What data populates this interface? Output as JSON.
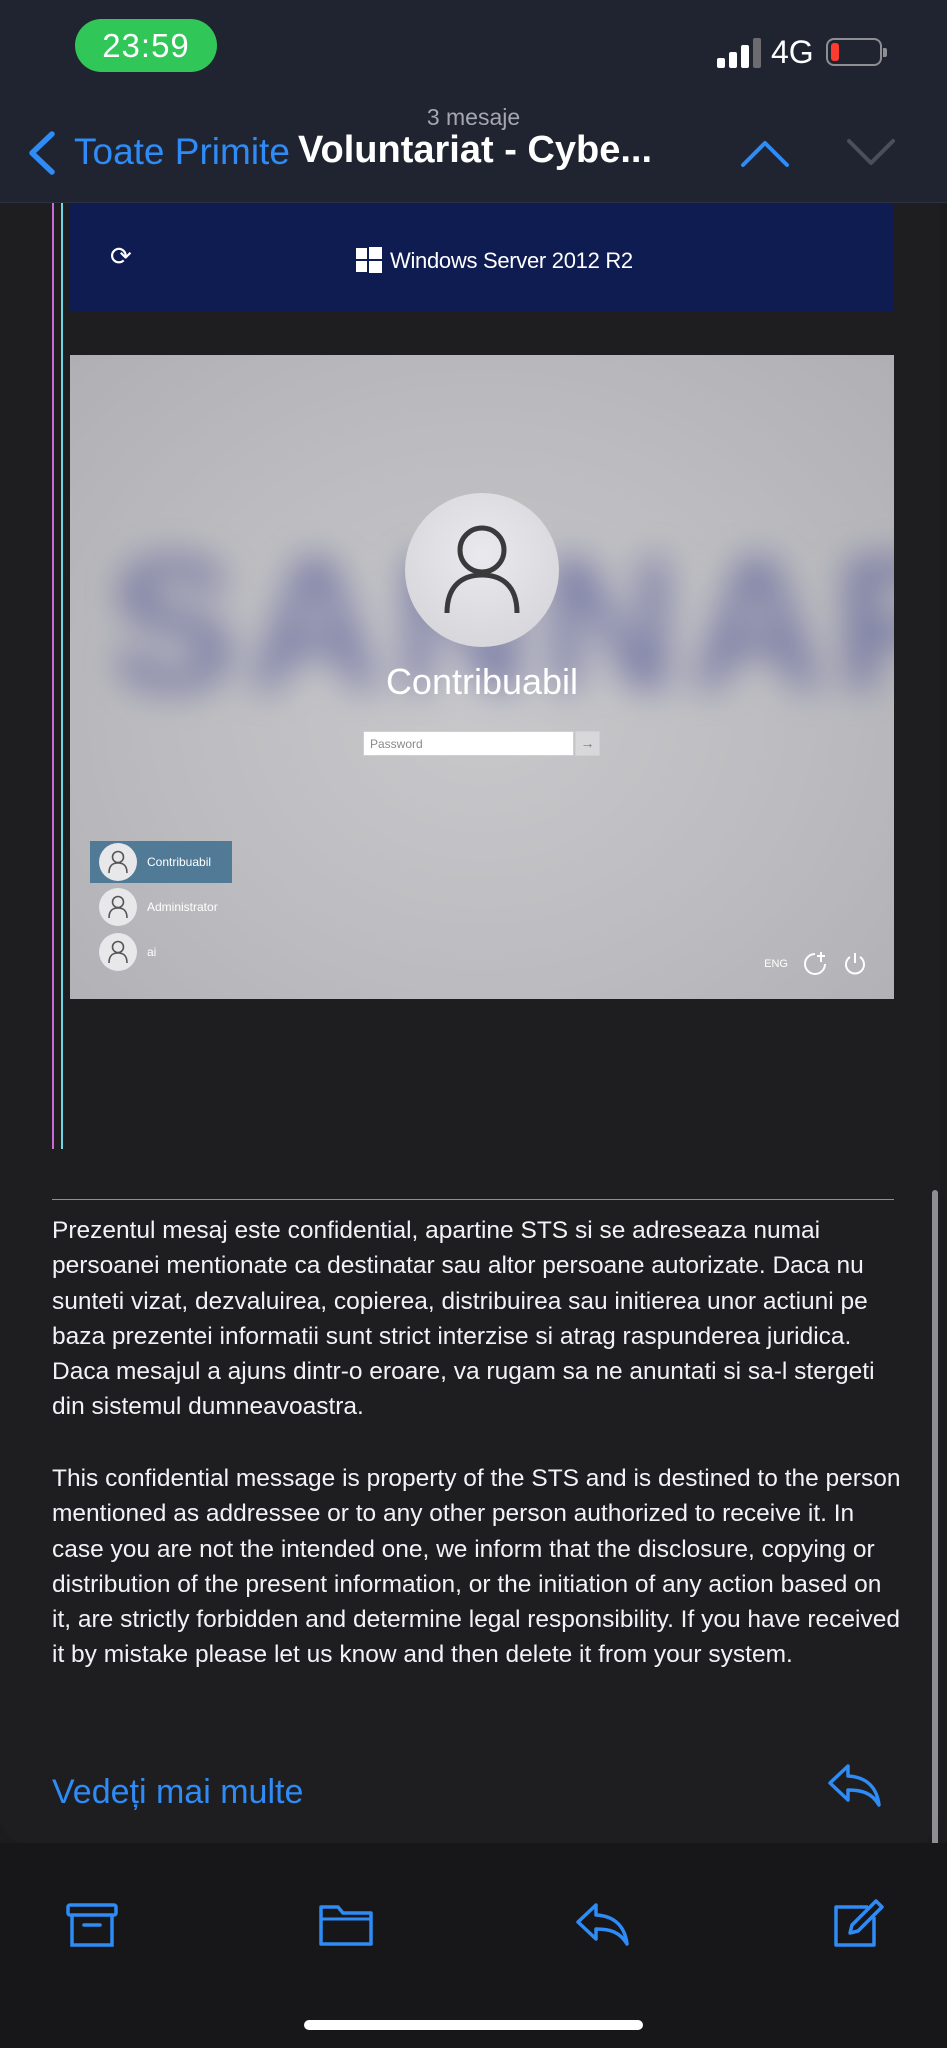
{
  "status_bar": {
    "time": "23:59",
    "network": "4G",
    "battery_level": 0.1,
    "battery_color": "#ff3b30",
    "time_pill_color": "#30c758"
  },
  "nav": {
    "message_count": "3 mesaje",
    "back_label": "Toate Primite",
    "subject": "Voluntariat - Cybe...",
    "accent_color": "#2f8bf5"
  },
  "screenshot": {
    "banner_title": "Windows Server 2012 R2",
    "login_user": "Contribuabil",
    "password_placeholder": "Password",
    "users": [
      "Contribuabil",
      "Administrator",
      "ai"
    ],
    "language": "ENG"
  },
  "disclaimer": {
    "ro": "Prezentul mesaj este confidential, apartine STS si se adreseaza numai persoanei mentionate ca destinatar sau altor persoane autorizate. Daca nu sunteti vizat, dezvaluirea, copierea, distribuirea sau initierea unor actiuni pe baza prezentei informatii sunt strict interzise si atrag raspunderea juridica. Daca mesajul a ajuns dintr-o eroare, va rugam sa ne anuntati si sa-l stergeti din sistemul dumneavoastra.",
    "en": "This confidential message is property of the STS and is destined to the person mentioned as addressee or to any other person authorized to receive it. In case you are not the intended one, we inform that the disclosure, copying or distribution of the present information, or the initiation of any action based on it, are strictly forbidden and determine legal responsibility. If you have received it by mistake please let us know and then delete it from your system."
  },
  "footer": {
    "see_more": "Vedeți mai multe"
  },
  "toolbar": {
    "icons": [
      "archive-icon",
      "folder-icon",
      "reply-icon",
      "compose-icon"
    ]
  }
}
